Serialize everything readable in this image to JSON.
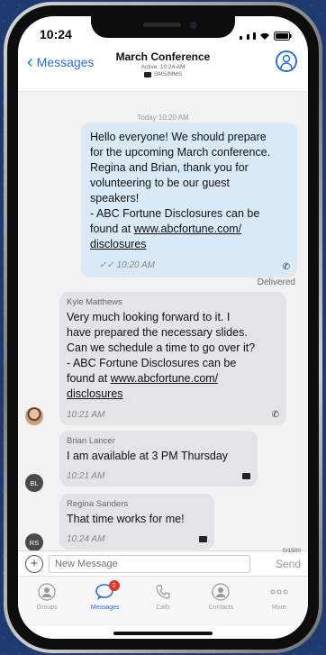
{
  "status": {
    "time": "10:24"
  },
  "nav": {
    "back_label": "Messages",
    "title": "March Conference",
    "active": "Active: 10:24 AM",
    "type": "SMS/MMS"
  },
  "chat": {
    "date": "Today 10:20 AM",
    "outgoing": {
      "lines": [
        "Hello everyone! We should prepare",
        "for the upcoming March conference.",
        "Regina and Brian, thank you for",
        "volunteering to be our guest",
        "speakers!",
        " - ABC Fortune Disclosures can be",
        "found at ",
        "www.abcfortune.com/",
        "disclosures"
      ],
      "time": "10:20 AM",
      "status": "Delivered"
    },
    "messages": [
      {
        "name": "Kyle Matthews",
        "lines": [
          "Very much looking forward to it. I",
          "have prepared the necessary slides.",
          "Can we schedule a time to go over it?",
          " - ABC Fortune Disclosures can be",
          "found at ",
          "www.abcfortune.com/",
          "disclosures"
        ],
        "time": "10:21 AM",
        "initials": ""
      },
      {
        "name": "Brian Lancer",
        "text": "I am available at 3 PM Thursday",
        "time": "10:21 AM",
        "initials": "BL"
      },
      {
        "name": "Regina Sanders",
        "text": "That time works for me!",
        "time": "10:24 AM",
        "initials": "RS"
      }
    ]
  },
  "composer": {
    "placeholder": "New Message",
    "count": "0/1500",
    "send": "Send"
  },
  "tabs": [
    {
      "label": "Groups",
      "icon": "groups-icon"
    },
    {
      "label": "Messages",
      "icon": "messages-icon",
      "badge": "2"
    },
    {
      "label": "Calls",
      "icon": "phone-icon"
    },
    {
      "label": "Contacts",
      "icon": "contacts-icon"
    },
    {
      "label": "More",
      "icon": "more-icon"
    }
  ],
  "colors": {
    "accent": "#2a6fd6",
    "outgoing_bubble": "#d9eaf6",
    "incoming_bubble": "#e4e4e8",
    "badge": "#e0342f"
  }
}
